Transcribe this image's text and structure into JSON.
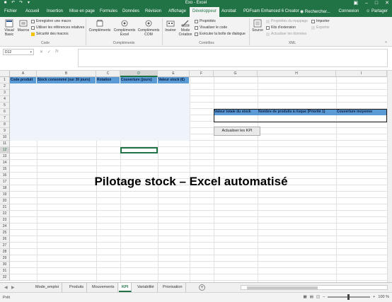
{
  "window": {
    "title": "Exo - Excel",
    "qat": [
      "save-icon",
      "undo-icon",
      "redo-icon",
      "customize-icon"
    ],
    "controls": [
      "ribbon-display-icon",
      "minimize-icon",
      "maximize-icon",
      "close-icon"
    ]
  },
  "tabs": [
    "Fichier",
    "Accueil",
    "Insertion",
    "Mise en page",
    "Formules",
    "Données",
    "Révision",
    "Affichage",
    "Développeur",
    "Acrobat",
    "PDFsam Enhanced 6 Creator"
  ],
  "active_tab": "Développeur",
  "tell_me": "Rechercher...",
  "account": {
    "signin": "Connexion",
    "share": "Partager"
  },
  "ribbon": {
    "code": {
      "label": "Code",
      "visual_basic": "Visual Basic",
      "macros": "Macros",
      "record_macro": "Enregistrer une macro",
      "relative_refs": "Utiliser les références relatives",
      "macro_security": "Sécurité des macros"
    },
    "addins": {
      "label": "Compléments",
      "complements": "Compléments",
      "complements_excel": "Compléments Excel",
      "complements_com": "Compléments COM"
    },
    "controls": {
      "label": "Contrôles",
      "insert": "Insérer",
      "design_mode": "Mode Création",
      "properties": "Propriétés",
      "view_code": "Visualiser le code",
      "run_dialog": "Exécuter la boîte de dialogue"
    },
    "xml": {
      "label": "XML",
      "source": "Source",
      "map_properties": "Propriétés du mappage",
      "expansion_packs": "Kits d'extension",
      "refresh_data": "Actualiser les données",
      "import": "Importer",
      "export": "Exporter"
    }
  },
  "formula_bar": {
    "name_box": "D12",
    "icons": [
      "cancel-icon",
      "enter-icon",
      "fx-icon"
    ],
    "formula": ""
  },
  "grid": {
    "columns": [
      "A",
      "B",
      "C",
      "D",
      "E",
      "F",
      "G",
      "H",
      "I"
    ],
    "rows": [
      "1",
      "2",
      "3",
      "4",
      "5",
      "6",
      "7",
      "8",
      "9",
      "10",
      "11",
      "12",
      "13",
      "14",
      "15",
      "16",
      "17",
      "18",
      "19",
      "20",
      "21",
      "22",
      "23",
      "24",
      "25",
      "26",
      "27",
      "28",
      "29",
      "30",
      "31",
      "32"
    ],
    "selected_cell": "D12",
    "table_headers": [
      "Code produit",
      "Stock consommé (sur 30 jours)",
      "Rotation",
      "Couverture (jours)",
      "Valeur stock (€)"
    ],
    "kpi_headers": [
      "Valeur totale du stock",
      "Nombre de produits à risque (Priorité 1)",
      "Couverture moyenne"
    ],
    "kpi_button": "Actualiser les KPI",
    "title_text": "Pilotage stock – Excel automatisé"
  },
  "sheets": {
    "tabs": [
      "Mode_emploi",
      "Produits",
      "Mouvements",
      "KPI",
      "Variabilité",
      "Priorisation"
    ],
    "active": "KPI"
  },
  "status": {
    "ready": "Prêt",
    "zoom": "100 %"
  }
}
